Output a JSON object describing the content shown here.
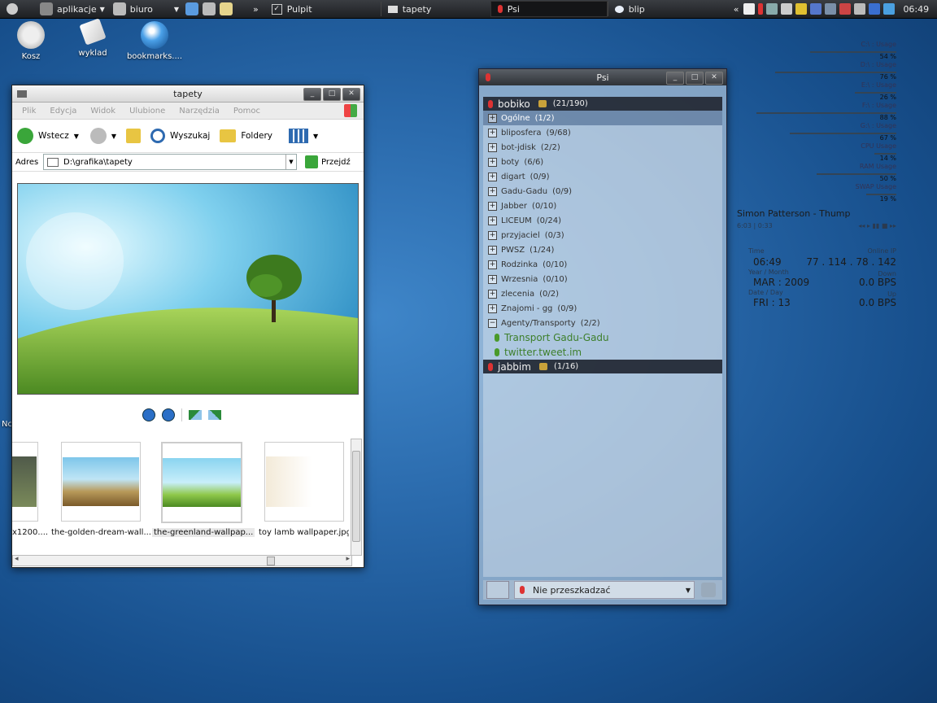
{
  "panel": {
    "menus": [
      "aplikacje",
      "biuro"
    ],
    "more": "»",
    "desktop_label": "Pulpit",
    "tasks": [
      "tapety",
      "Psi",
      "blip"
    ],
    "tray_more": "«",
    "clock": "06:49"
  },
  "desktop_icons": [
    "Kosz",
    "wyklad",
    "bookmarks...."
  ],
  "desktop_partial_label": "Nc",
  "explorer": {
    "title": "tapety",
    "menu": [
      "Plik",
      "Edycja",
      "Widok",
      "Ulubione",
      "Narzędzia",
      "Pomoc"
    ],
    "toolbar": {
      "back": "Wstecz",
      "search": "Wyszukaj",
      "folders": "Foldery"
    },
    "address_label": "Adres",
    "address_value": "D:\\grafika\\tapety",
    "go": "Przejdź",
    "thumbnails": [
      {
        "label": "x1200....",
        "selected": false
      },
      {
        "label": "the-golden-dream-wall...",
        "selected": false
      },
      {
        "label": "the-greenland-wallpap...",
        "selected": true
      },
      {
        "label": "toy lamb wallpaper.jpg",
        "selected": false
      }
    ]
  },
  "psi": {
    "title": "Psi",
    "accounts": [
      {
        "name": "bobiko",
        "count": "(21/190)"
      },
      {
        "name": "jabbim",
        "count": "(1/16)"
      }
    ],
    "groups": [
      {
        "name": "Ogólne",
        "count": "(1/2)",
        "selected": true,
        "sign": "+"
      },
      {
        "name": "bliposfera",
        "count": "(9/68)",
        "selected": false,
        "sign": "+"
      },
      {
        "name": "bot-jdisk",
        "count": "(2/2)",
        "selected": false,
        "sign": "+"
      },
      {
        "name": "boty",
        "count": "(6/6)",
        "selected": false,
        "sign": "+"
      },
      {
        "name": "digart",
        "count": "(0/9)",
        "selected": false,
        "sign": "+"
      },
      {
        "name": "Gadu-Gadu",
        "count": "(0/9)",
        "selected": false,
        "sign": "+"
      },
      {
        "name": "Jabber",
        "count": "(0/10)",
        "selected": false,
        "sign": "+"
      },
      {
        "name": "LICEUM",
        "count": "(0/24)",
        "selected": false,
        "sign": "+"
      },
      {
        "name": "przyjaciel",
        "count": "(0/3)",
        "selected": false,
        "sign": "+"
      },
      {
        "name": "PWSZ",
        "count": "(1/24)",
        "selected": false,
        "sign": "+"
      },
      {
        "name": "Rodzinka",
        "count": "(0/10)",
        "selected": false,
        "sign": "+"
      },
      {
        "name": "Wrzesnia",
        "count": "(0/10)",
        "selected": false,
        "sign": "+"
      },
      {
        "name": "zlecenia",
        "count": "(0/2)",
        "selected": false,
        "sign": "+"
      },
      {
        "name": "Znajomi - gg",
        "count": "(0/9)",
        "selected": false,
        "sign": "+"
      },
      {
        "name": "Agenty/Transporty",
        "count": "(2/2)",
        "selected": false,
        "sign": "−"
      }
    ],
    "contacts": [
      "Transport Gadu-Gadu",
      "twitter.tweet.im"
    ],
    "status": "Nie przeszkadzać"
  },
  "conky": {
    "meters": [
      {
        "label": "C:\\ : Usage",
        "value": "54 %",
        "fraction": 0.54
      },
      {
        "label": "D:\\ : Usage",
        "value": "76 %",
        "fraction": 0.76
      },
      {
        "label": "E:\\ : Usage",
        "value": "26 %",
        "fraction": 0.26
      },
      {
        "label": "F:\\ : Usage",
        "value": "88 %",
        "fraction": 0.88
      },
      {
        "label": "G:\\ : Usage",
        "value": "67 %",
        "fraction": 0.67
      },
      {
        "label": "CPU Usage",
        "value": "14 %",
        "fraction": 0.14
      },
      {
        "label": "RAM Usage",
        "value": "50 %",
        "fraction": 0.5
      },
      {
        "label": "SWAP Usage",
        "value": "19 %",
        "fraction": 0.19
      }
    ],
    "track": "Simon Patterson - Thump",
    "track_time": "6:03 | 0:33",
    "media_controls": "◂◂  ▸  ▮▮  ■  ▸▸",
    "time_label": "Time",
    "time": "06:49",
    "ip_label": "Online IP",
    "ip": "77 . 114 . 78 . 142",
    "ym_label": "Year / Month",
    "ym": "MAR : 2009",
    "down_label": "Down",
    "down": "0.0 BPS",
    "dd_label": "Date / Day",
    "dd": "FRI : 13",
    "up_label": "Up",
    "up": "0.0 BPS"
  }
}
